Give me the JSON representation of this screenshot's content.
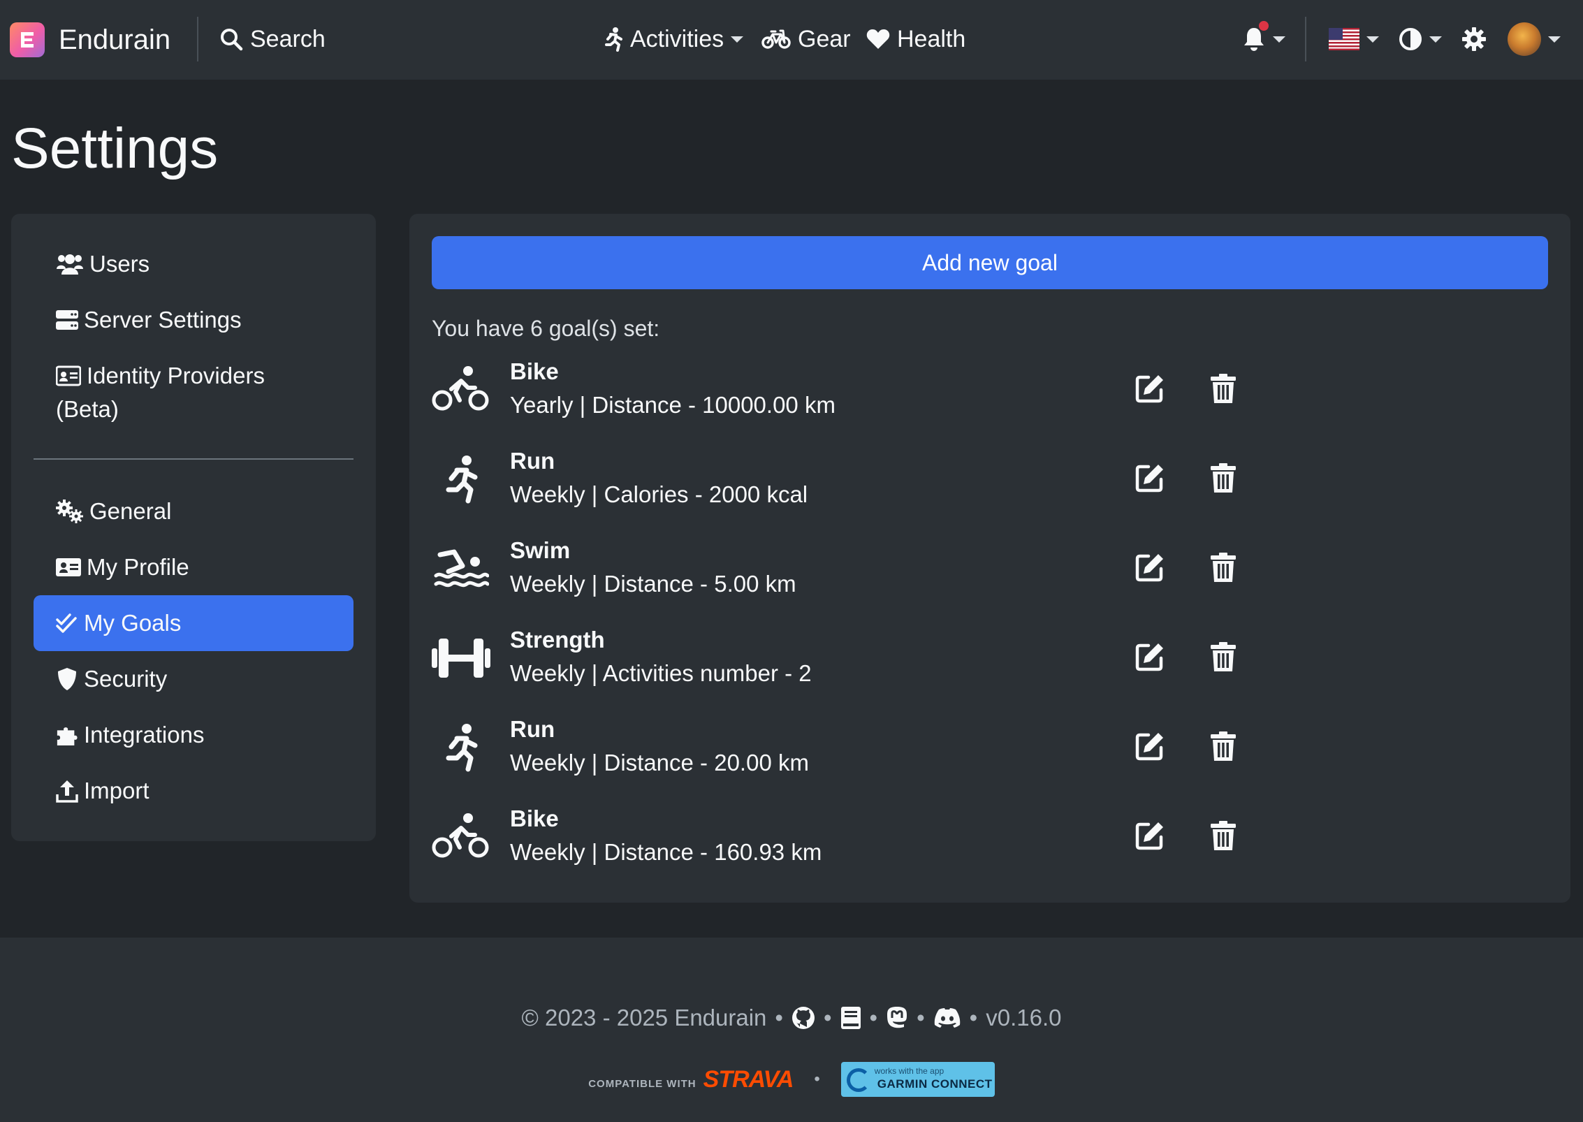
{
  "navbar": {
    "brand": "Endurain",
    "search_label": "Search",
    "activities_label": "Activities",
    "gear_label": "Gear",
    "health_label": "Health"
  },
  "page": {
    "title": "Settings"
  },
  "sidebar": {
    "items": [
      {
        "label": "Users",
        "icon": "users-icon"
      },
      {
        "label": "Server Settings",
        "icon": "server-icon"
      },
      {
        "label": "Identity Providers",
        "label2": "(Beta)",
        "icon": "id-card-icon"
      },
      {
        "label": "General",
        "icon": "gears-icon"
      },
      {
        "label": "My Profile",
        "icon": "profile-card-icon"
      },
      {
        "label": "My Goals",
        "icon": "double-check-icon",
        "active": true
      },
      {
        "label": "Security",
        "icon": "shield-icon"
      },
      {
        "label": "Integrations",
        "icon": "puzzle-icon"
      },
      {
        "label": "Import",
        "icon": "upload-icon"
      }
    ]
  },
  "goals": {
    "add_button": "Add new goal",
    "count_text": "You have 6 goal(s) set:",
    "items": [
      {
        "name": "Bike",
        "description": "Yearly | Distance - 10000.00 km",
        "icon": "bike-icon"
      },
      {
        "name": "Run",
        "description": "Weekly | Calories - 2000 kcal",
        "icon": "run-icon"
      },
      {
        "name": "Swim",
        "description": "Weekly | Distance - 5.00 km",
        "icon": "swim-icon"
      },
      {
        "name": "Strength",
        "description": "Weekly | Activities number - 2",
        "icon": "dumbbell-icon"
      },
      {
        "name": "Run",
        "description": "Weekly | Distance - 20.00 km",
        "icon": "run-icon"
      },
      {
        "name": "Bike",
        "description": "Weekly | Distance - 160.93 km",
        "icon": "bike-icon"
      }
    ]
  },
  "footer": {
    "copyright": "© 2023 - 2025 Endurain",
    "version": "v0.16.0",
    "strava_small": "COMPATIBLE WITH",
    "strava_big": "STRAVA",
    "garmin_small": "works with the app",
    "garmin_main": "GARMIN CONNECT"
  },
  "colors": {
    "background": "#212529",
    "surface": "#2b3035",
    "accent": "#3b71ee",
    "notification": "#dc3545",
    "strava": "#fc4c02"
  }
}
